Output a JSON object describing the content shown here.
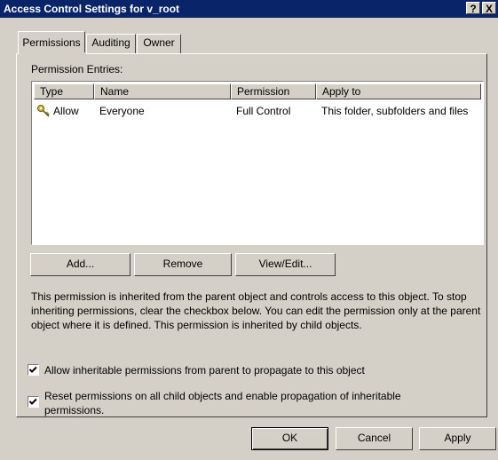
{
  "window": {
    "title": "Access Control Settings for v_root",
    "help_btn": "?",
    "close_btn": "X"
  },
  "tabs": [
    {
      "label": "Permissions",
      "active": true
    },
    {
      "label": "Auditing",
      "active": false
    },
    {
      "label": "Owner",
      "active": false
    }
  ],
  "permission_entries": {
    "label": "Permission Entries:",
    "columns": [
      "Type",
      "Name",
      "Permission",
      "Apply to"
    ],
    "rows": [
      {
        "icon": "key-icon",
        "type": "Allow",
        "name": "Everyone",
        "permission": "Full Control",
        "apply_to": "This folder, subfolders and files"
      }
    ]
  },
  "buttons": {
    "add": "Add...",
    "remove": "Remove",
    "view_edit": "View/Edit...",
    "ok": "OK",
    "cancel": "Cancel",
    "apply": "Apply"
  },
  "info_text": "This permission is inherited from the parent object and controls access to this object.  To stop inheriting permissions, clear the checkbox below.  You can edit the permission only at the parent object where it is defined. This permission is inherited by child objects.",
  "checkboxes": [
    {
      "label": "Allow inheritable permissions from parent to propagate to this object",
      "checked": true
    },
    {
      "label": "Reset permissions on all child objects and enable propagation of inheritable permissions.",
      "checked": true
    }
  ]
}
